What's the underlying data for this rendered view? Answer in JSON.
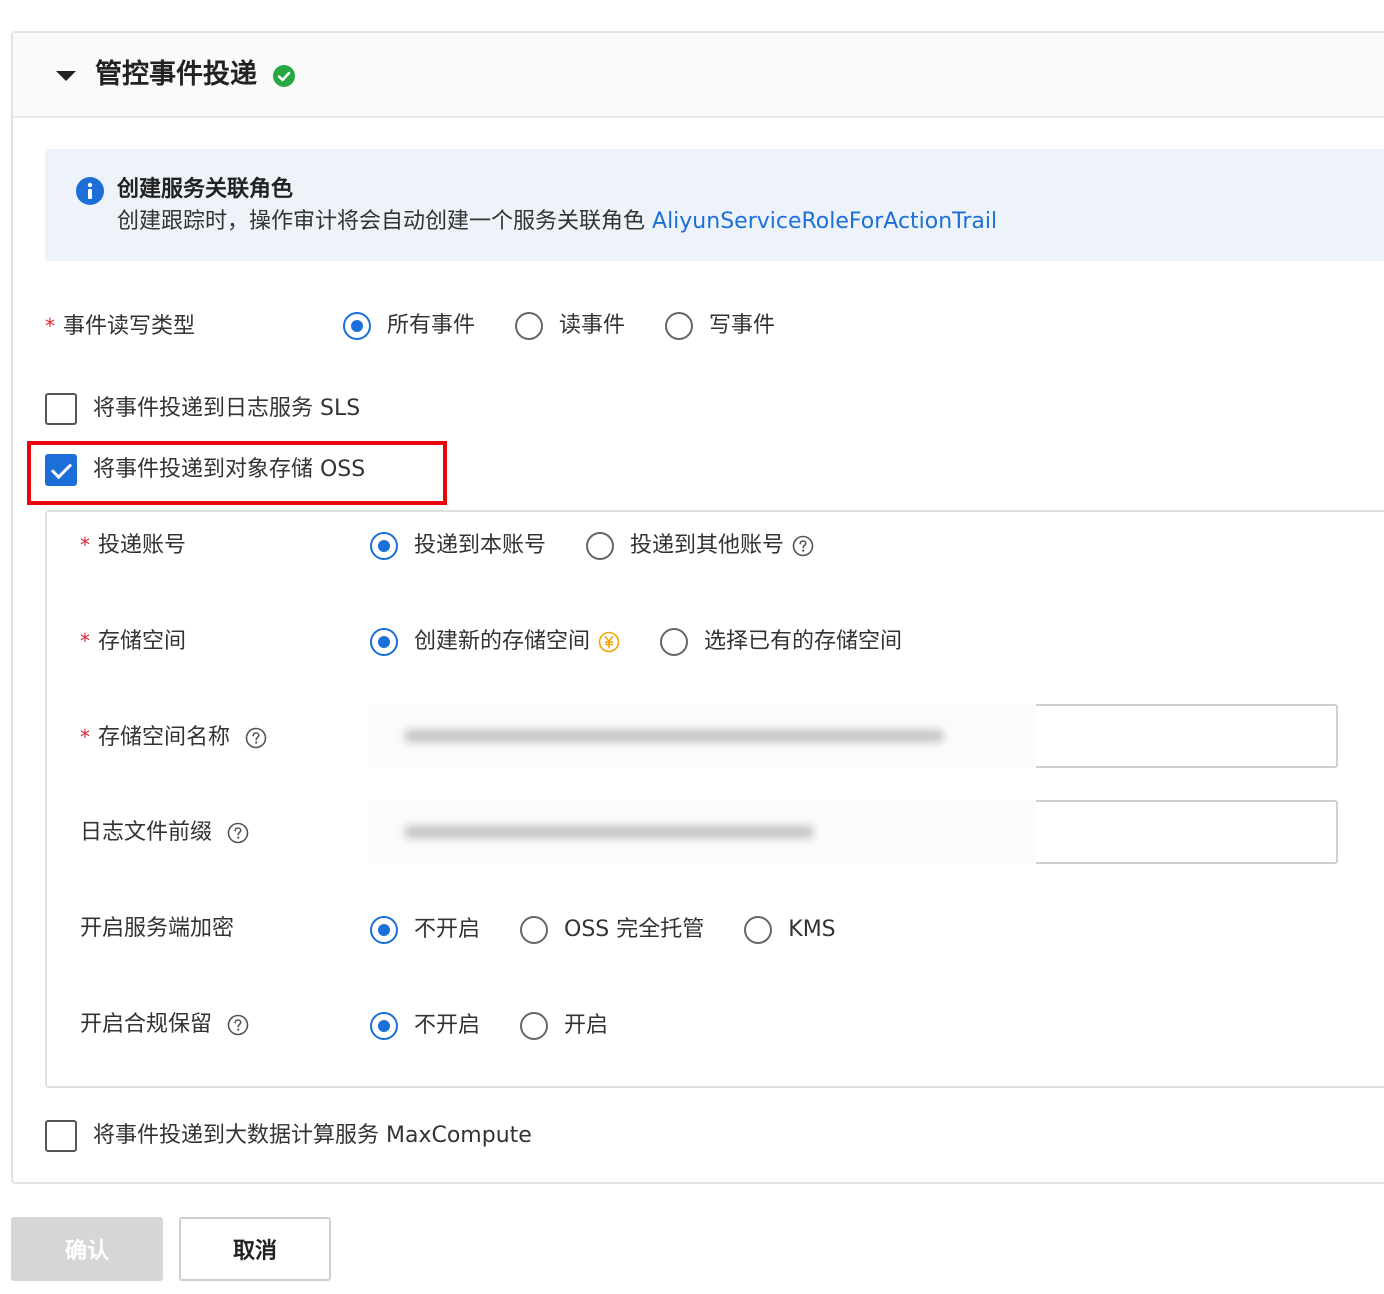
{
  "panel": {
    "title": "管控事件投递",
    "status_icon": "check-circle-icon",
    "status_color": "#29a745"
  },
  "info": {
    "title": "创建服务关联角色",
    "text": "创建跟踪时，操作审计将会自动创建一个服务关联角色",
    "link": "AliyunServiceRoleForActionTrail",
    "icon": "info-icon"
  },
  "event_type": {
    "label": "事件读写类型",
    "options": [
      "所有事件",
      "读事件",
      "写事件"
    ],
    "selected": "所有事件"
  },
  "deliver_sls": {
    "label": "将事件投递到日志服务 SLS",
    "checked": false
  },
  "deliver_oss": {
    "label": "将事件投递到对象存储 OSS",
    "checked": true
  },
  "oss": {
    "account": {
      "label": "投递账号",
      "options": [
        "投递到本账号",
        "投递到其他账号"
      ],
      "selected": "投递到本账号"
    },
    "bucket": {
      "label": "存储空间",
      "options": [
        "创建新的存储空间",
        "选择已有的存储空间"
      ],
      "selected": "创建新的存储空间"
    },
    "bucket_name": {
      "label": "存储空间名称",
      "value": ""
    },
    "log_prefix": {
      "label": "日志文件前缀",
      "value": ""
    },
    "encryption": {
      "label": "开启服务端加密",
      "options": [
        "不开启",
        "OSS 完全托管",
        "KMS"
      ],
      "selected": "不开启"
    },
    "retention": {
      "label": "开启合规保留",
      "options": [
        "不开启",
        "开启"
      ],
      "selected": "不开启"
    }
  },
  "deliver_maxcompute": {
    "label": "将事件投递到大数据计算服务 MaxCompute",
    "checked": false
  },
  "buttons": {
    "confirm": "确认",
    "cancel": "取消"
  },
  "colors": {
    "accent": "#1c6fd8",
    "required": "#e3262c",
    "highlight": "#e8070c",
    "yuan": "#f0a500"
  }
}
